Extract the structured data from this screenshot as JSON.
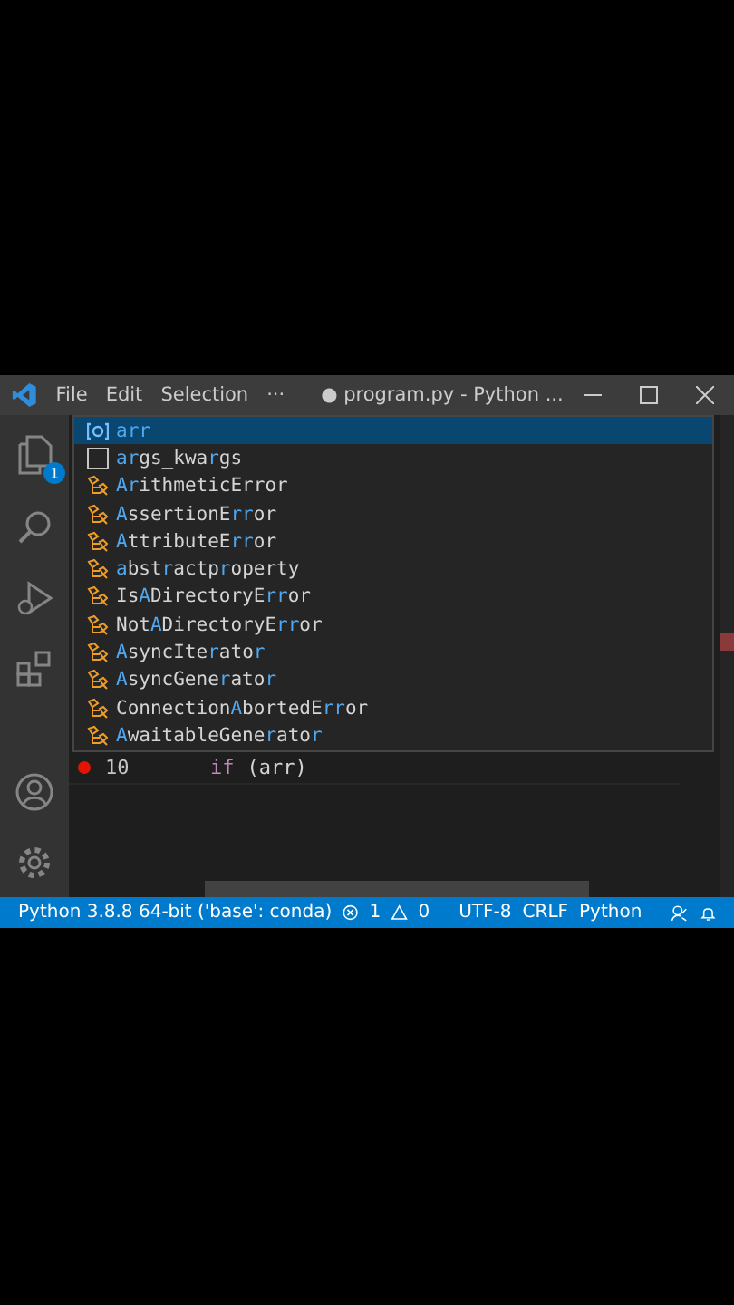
{
  "title_bar": {
    "menu": [
      "File",
      "Edit",
      "Selection",
      "···"
    ],
    "title": "● program.py - Python ..."
  },
  "activity_bar": {
    "explorer_badge": "1"
  },
  "suggestions": [
    {
      "kind": "variable",
      "label": "**arr**",
      "selected": true
    },
    {
      "kind": "text",
      "label": "**ar**gs_kwa**r**gs",
      "selected": false
    },
    {
      "kind": "class",
      "label": "**Ar**ithmeticError",
      "selected": false
    },
    {
      "kind": "class",
      "label": "**A**ssertionE**rr**or",
      "selected": false
    },
    {
      "kind": "class",
      "label": "**A**ttributeE**rr**or",
      "selected": false
    },
    {
      "kind": "class",
      "label": "**a**bst**r**actp**r**operty",
      "selected": false
    },
    {
      "kind": "class",
      "label": "Is**A**DirectoryE**rr**or",
      "selected": false
    },
    {
      "kind": "class",
      "label": "Not**A**DirectoryE**rr**or",
      "selected": false
    },
    {
      "kind": "class",
      "label": "**A**syncIte**r**ato**r**",
      "selected": false
    },
    {
      "kind": "class",
      "label": "**A**syncGene**r**ato**r**",
      "selected": false
    },
    {
      "kind": "class",
      "label": "Connection**A**bortedE**rr**or",
      "selected": false
    },
    {
      "kind": "class",
      "label": "**A**waitableGene**r**ato**r**",
      "selected": false
    }
  ],
  "editor": {
    "line": {
      "number": "10",
      "breakpoint": true,
      "keyword": "if",
      "code": "(arr)"
    }
  },
  "status_bar": {
    "interpreter": "Python 3.8.8 64-bit ('base': conda)",
    "errors": "1",
    "warnings": "0",
    "encoding": "UTF-8",
    "eol": "CRLF",
    "language": "Python"
  }
}
